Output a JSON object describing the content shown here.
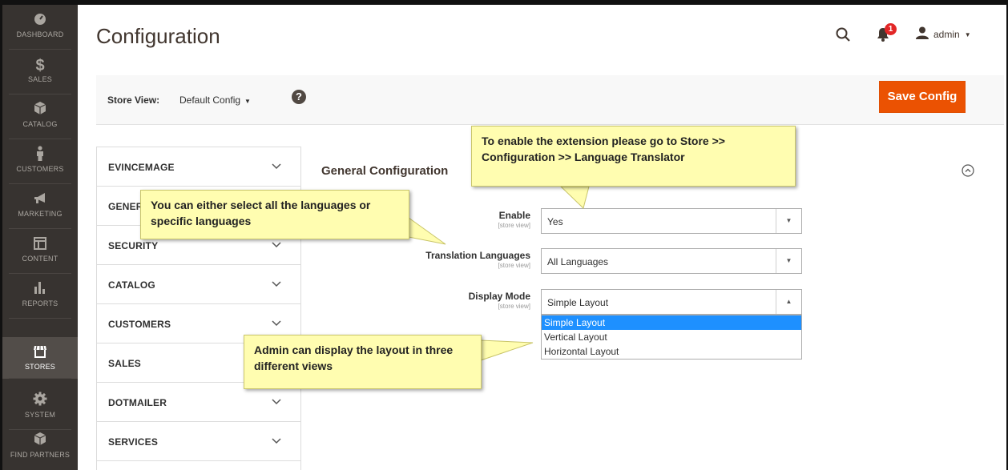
{
  "sidebar": {
    "items": [
      {
        "label": "DASHBOARD",
        "icon": "dashboard-icon"
      },
      {
        "label": "SALES",
        "icon": "dollar-icon"
      },
      {
        "label": "CATALOG",
        "icon": "box-icon"
      },
      {
        "label": "CUSTOMERS",
        "icon": "person-icon"
      },
      {
        "label": "MARKETING",
        "icon": "megaphone-icon"
      },
      {
        "label": "CONTENT",
        "icon": "layout-icon"
      },
      {
        "label": "REPORTS",
        "icon": "bar-chart-icon"
      },
      {
        "label": "STORES",
        "icon": "store-icon"
      },
      {
        "label": "SYSTEM",
        "icon": "gear-icon"
      },
      {
        "label": "FIND PARTNERS",
        "icon": "partners-box-icon"
      }
    ],
    "active": "STORES"
  },
  "header": {
    "title": "Configuration",
    "notifications_count": "1",
    "user": "admin"
  },
  "store_bar": {
    "label": "Store View:",
    "value": "Default Config",
    "save_label": "Save Config"
  },
  "config_nav": [
    "EVINCEMAGE",
    "GENERAL",
    "SECURITY",
    "CATALOG",
    "CUSTOMERS",
    "SALES",
    "DOTMAILER",
    "SERVICES"
  ],
  "section": {
    "title": "General Configuration"
  },
  "fields": {
    "enable": {
      "label": "Enable",
      "scope": "[store view]",
      "value": "Yes"
    },
    "languages": {
      "label": "Translation Languages",
      "scope": "[store view]",
      "value": "All Languages"
    },
    "display_mode": {
      "label": "Display Mode",
      "scope": "[store view]",
      "value": "Simple Layout",
      "options": [
        "Simple Layout",
        "Vertical Layout",
        "Horizontal Layout"
      ]
    }
  },
  "callouts": {
    "top": "To enable the extension please go to Store >> Configuration >> Language Translator",
    "languages": "You can either select all the languages or specific languages",
    "layout": "Admin can display the layout in three different views"
  },
  "colors": {
    "sidebar_bg": "#373330",
    "sidebar_active": "#524d49",
    "save_button": "#eb5202",
    "callout_bg": "#fffdb0",
    "selected_option": "#1e90ff"
  }
}
